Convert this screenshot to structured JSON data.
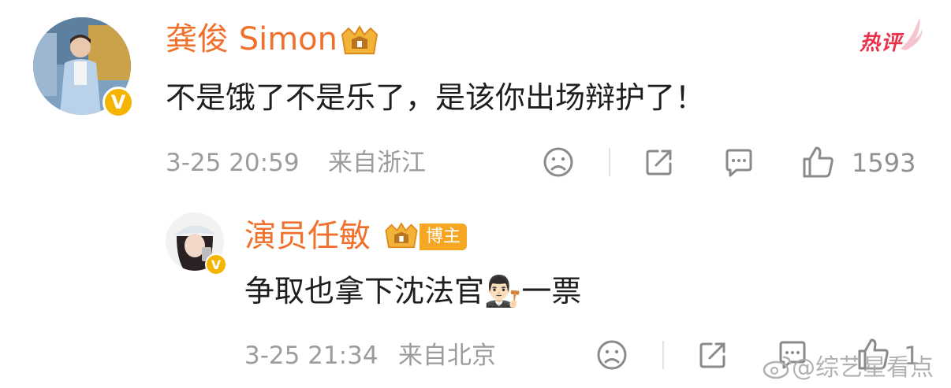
{
  "comments": [
    {
      "user": "龚俊 Simon",
      "text": "不是饿了不是乐了，是该你出场辩护了！",
      "timestamp": "3-25 20:59",
      "location": "来自浙江",
      "likes": "1593",
      "hot_label": "热评"
    },
    {
      "user": "演员任敏",
      "badge_label": "博主",
      "text_before": "争取也拿下沈法官",
      "emoji": "👨🏻‍⚖️",
      "text_after": "一票",
      "timestamp": "3-25 21:34",
      "location": "来自北京",
      "likes": "1"
    }
  ],
  "watermark": "@综艺星看点",
  "colors": {
    "name": "#f0712c",
    "hot": "#e8314a",
    "vip": "#f5b400",
    "meta": "#9c9c9c"
  },
  "icons": [
    "verified-v-icon",
    "vip-crown-icon",
    "sad-face-icon",
    "share-icon",
    "comment-icon",
    "thumb-up-icon",
    "weibo-logo-icon"
  ]
}
